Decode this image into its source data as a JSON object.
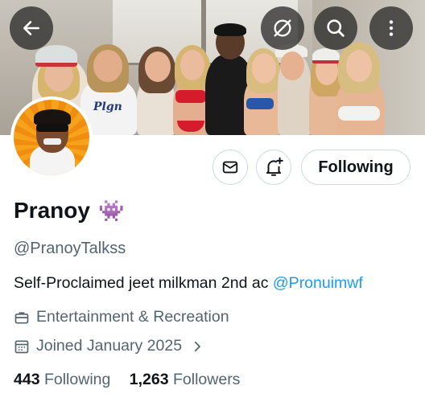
{
  "header": {
    "back_icon": "arrow-left-icon",
    "hide_icon": "eye-off-icon",
    "search_icon": "search-icon",
    "more_icon": "more-vertical-icon"
  },
  "banner": {
    "jersey_text": "Plgn"
  },
  "actions": {
    "message_icon": "envelope-icon",
    "notify_icon": "bell-plus-icon",
    "follow_label": "Following"
  },
  "profile": {
    "name": "Pranoy",
    "badge_emoji": "👾",
    "handle": "@PranoyTalkss",
    "bio_text": "Self-Proclaimed jeet milkman 2nd ac ",
    "bio_mention": "@Pronuimwf",
    "category": "Entertainment & Recreation",
    "joined": "Joined January 2025"
  },
  "stats": {
    "following_count": "443",
    "following_label": " Following",
    "followers_count": "1,263",
    "followers_label": " Followers"
  },
  "colors": {
    "link": "#1d9bf0",
    "muted": "#536471",
    "text": "#0f1419",
    "border": "#cfd9de"
  }
}
